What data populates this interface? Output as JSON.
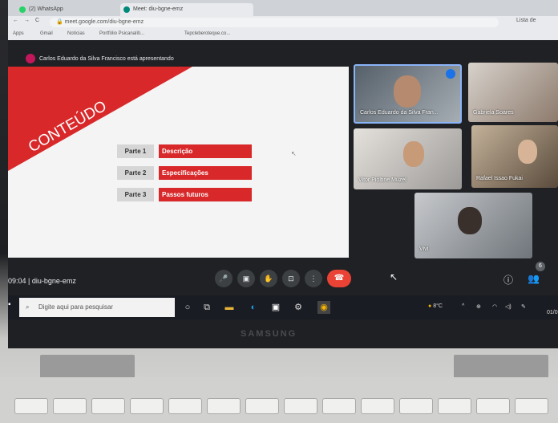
{
  "browser": {
    "tabs": [
      {
        "label": "(2) WhatsApp",
        "color": "#25d366"
      },
      {
        "label": "Meet: diu-bgne-emz",
        "color": "#00897b"
      }
    ],
    "address": "meet.google.com/diu-bgne-emz",
    "reading_list": "Lista de",
    "bookmarks": [
      "Apps",
      "Gmail",
      "Notícias",
      "Portfólio Psicanalíti...",
      "Tepcleberoteque.co..."
    ]
  },
  "meet": {
    "presenting_text": "Carlos Eduardo da Silva Francisco está apresentando",
    "meeting_time": "09:04",
    "meeting_code": "diu-bgne-emz",
    "participants_badge": "6",
    "participants": [
      {
        "name": "Carlos Eduardo da Silva Fran..."
      },
      {
        "name": "Gabriela Soares"
      },
      {
        "name": "Vitor Pioltine Muzel"
      },
      {
        "name": "Rafael Issao Fukai"
      },
      {
        "name": "Vivi"
      }
    ]
  },
  "slide": {
    "title": "CONTEÚDO",
    "rows": [
      {
        "label": "Parte 1",
        "value": "Descrição"
      },
      {
        "label": "Parte 2",
        "value": "Especificações"
      },
      {
        "label": "Parte 3",
        "value": "Passos futuros"
      }
    ]
  },
  "taskbar": {
    "search_placeholder": "Digite aqui para pesquisar",
    "temperature": "8°C",
    "date": "01/0"
  },
  "laptop": {
    "brand": "SAMSUNG"
  },
  "colors": {
    "slide_red": "#d8282a",
    "meet_bg": "#202124",
    "end_call": "#ea4335"
  }
}
